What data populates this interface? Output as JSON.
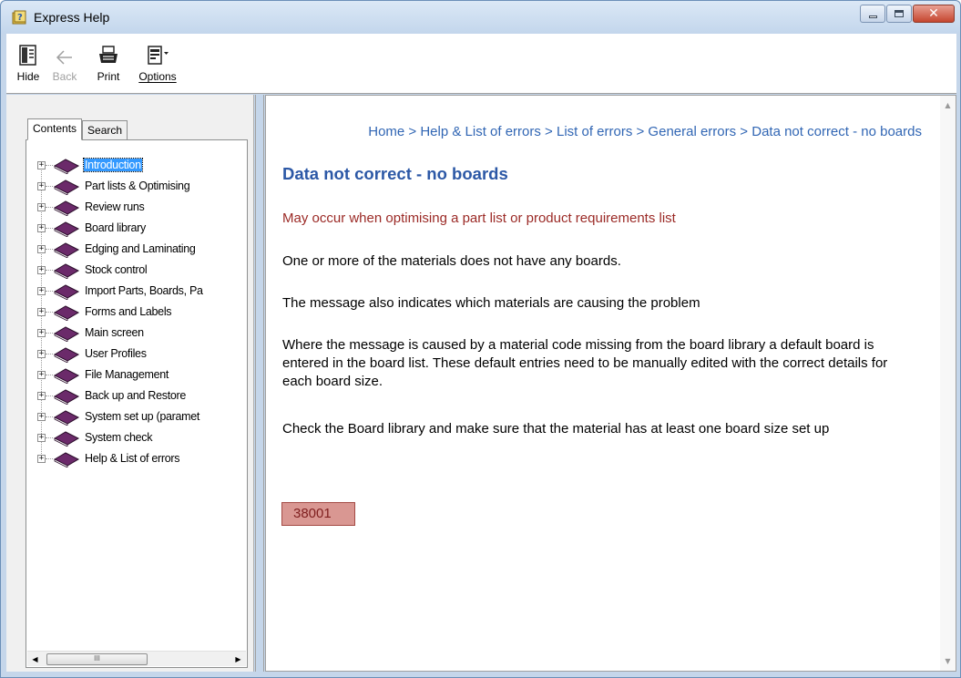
{
  "window": {
    "title": "Express Help",
    "controls": {
      "minimize": "minimize",
      "maximize": "maximize",
      "close": "close"
    }
  },
  "toolbar": {
    "hide_label": "Hide",
    "back_label": "Back",
    "print_label": "Print",
    "options_label": "Options"
  },
  "tabs": {
    "contents_label": "Contents",
    "search_label": "Search"
  },
  "tree": {
    "items": [
      {
        "label": "Introduction",
        "selected": true
      },
      {
        "label": "Part lists & Optimising"
      },
      {
        "label": "Review runs"
      },
      {
        "label": "Board library"
      },
      {
        "label": "Edging and Laminating"
      },
      {
        "label": "Stock control"
      },
      {
        "label": "Import Parts, Boards, Pa"
      },
      {
        "label": "Forms and Labels"
      },
      {
        "label": "Main screen"
      },
      {
        "label": "User Profiles"
      },
      {
        "label": "File Management"
      },
      {
        "label": "Back up and Restore"
      },
      {
        "label": "System set up (paramet"
      },
      {
        "label": "System check"
      },
      {
        "label": "Help & List of errors"
      }
    ],
    "expander_glyph": "+",
    "scroll_thumb_glyph": "III"
  },
  "content": {
    "breadcrumb": "Home > Help & List of errors > List of errors > General errors > Data not correct - no boards",
    "title": "Data not correct - no boards",
    "subtitle": "May occur when optimising a part list or product requirements list",
    "paragraphs": [
      "One or more of the materials does not have any boards.",
      "The message also indicates which materials are causing the problem",
      "Where the message is caused by a material code missing from the board library a default board is entered in the board list. These default entries need to be manually edited with the correct details for each board size.",
      "Check the Board library and make sure that the material has at least one board size set up"
    ],
    "error_code": "38001"
  },
  "colors": {
    "link_blue": "#3166b4",
    "title_blue": "#2c58a6",
    "subtitle_red": "#9b2a26",
    "badge_fill": "#d99792",
    "selection": "#3399ff",
    "book_purple": "#6b2a6a"
  },
  "icons": {
    "title": "help-book-icon",
    "hide": "hide-pane-icon",
    "back": "back-arrow-icon",
    "print": "printer-icon",
    "options": "options-icon",
    "tree_item": "closed-book-icon"
  }
}
